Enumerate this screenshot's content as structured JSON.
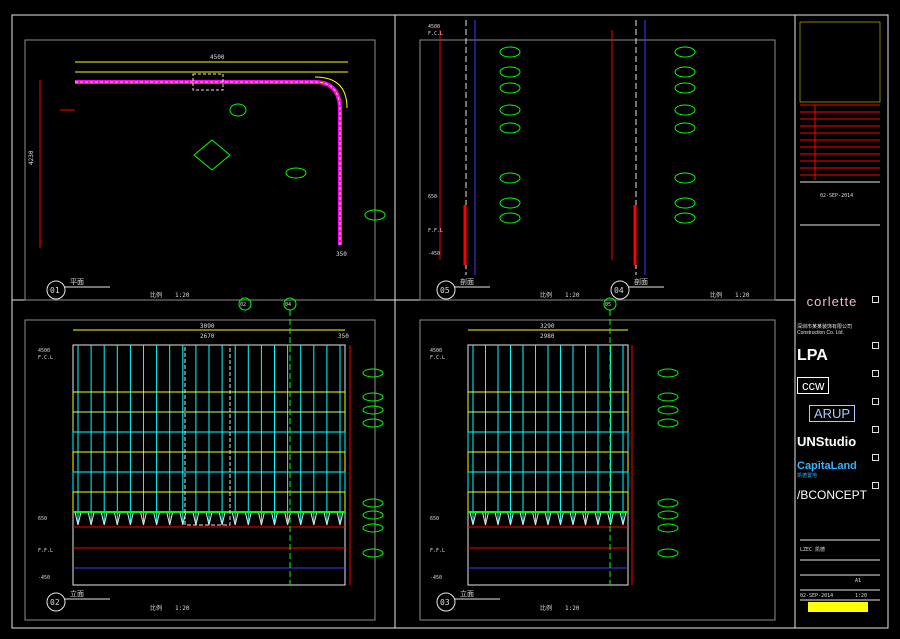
{
  "drawing": {
    "views": [
      {
        "id": "plan",
        "number": "01",
        "title": "平面",
        "scale_label": "比例",
        "scale": "1:20"
      },
      {
        "id": "sec1",
        "number": "05",
        "title": "剖面",
        "scale_label": "比例",
        "scale": "1:20"
      },
      {
        "id": "sec2",
        "number": "04",
        "title": "剖面",
        "scale_label": "比例",
        "scale": "1:20"
      },
      {
        "id": "elev1",
        "number": "02",
        "title": "立面",
        "scale_label": "比例",
        "scale": "1:20"
      },
      {
        "id": "elev2",
        "number": "03",
        "title": "立面",
        "scale_label": "比例",
        "scale": "1:20"
      }
    ],
    "plan_dims": {
      "width": "4500",
      "height": "4230",
      "side": "350"
    },
    "elev_dims": {
      "e1_top": "3090",
      "e1_sub": "2670",
      "e2_top": "3290",
      "e2_sub": "2980",
      "right": "350"
    },
    "levels": {
      "top": "4500",
      "top_sub": "F.C.L",
      "ffl": "F.F.L",
      "low": "-450",
      "mid": "650"
    },
    "tags": [
      "FB-400",
      "W1-400",
      "P1-400",
      "CL-400",
      "CT-400",
      "S1-400"
    ],
    "callouts": {
      "c1": "02",
      "c2": "04",
      "c3": "05"
    }
  },
  "title_block": {
    "logos": [
      {
        "name": "corlette",
        "text": "corlette"
      },
      {
        "name": "company-cn",
        "text": "深圳市某某装饰有限公司",
        "sub": "Construction Co. Ltd."
      },
      {
        "name": "lpa",
        "text": "LPA"
      },
      {
        "name": "ccw",
        "text": "ccw"
      },
      {
        "name": "arup",
        "text": "ARUP"
      },
      {
        "name": "unstudio",
        "text": "UNStudio"
      },
      {
        "name": "capitaland",
        "text": "CapitaLand",
        "sub": "凯德置地"
      },
      {
        "name": "bconcept",
        "text": "/BCONCEPT"
      }
    ],
    "date": "02-SEP-2014",
    "project_label": "LZEC 凯德",
    "sheet": "A1",
    "scale": "1:20"
  },
  "colors": {
    "yellow": "#ffff00",
    "red": "#ff0000",
    "green": "#00ff00",
    "cyan": "#00ffff",
    "magenta": "#ff00ff",
    "blue": "#3a3aff",
    "white": "#e6e6e6",
    "grey": "#8c8c8c"
  }
}
